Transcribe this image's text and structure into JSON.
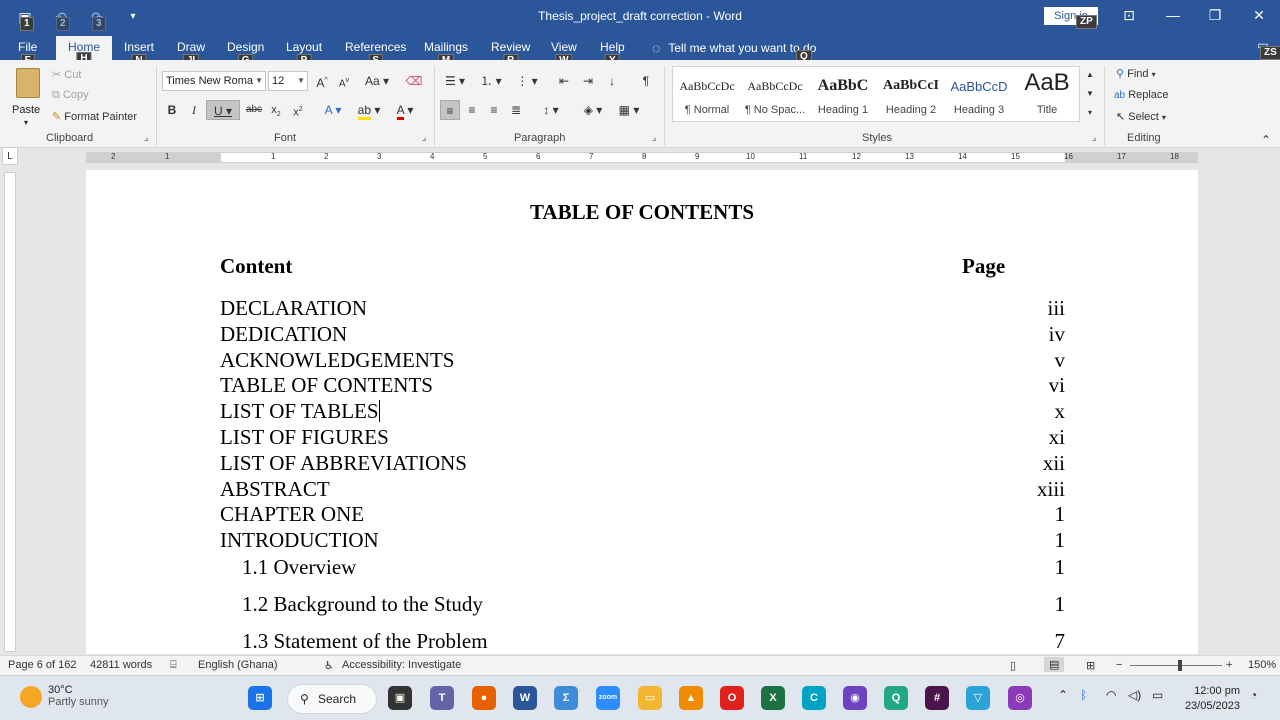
{
  "window": {
    "title": "Thesis_project_draft correction  -  Word",
    "signin_label": "Sign in",
    "signin_keytip": "ZP",
    "qat_keytips": [
      "1",
      "2",
      "3"
    ],
    "tellme_keytip": "Q"
  },
  "tabs": [
    {
      "label": "File",
      "keytip": "F"
    },
    {
      "label": "Home",
      "keytip": "H"
    },
    {
      "label": "Insert",
      "keytip": "N"
    },
    {
      "label": "Draw",
      "keytip": "JI"
    },
    {
      "label": "Design",
      "keytip": "G"
    },
    {
      "label": "Layout",
      "keytip": "P"
    },
    {
      "label": "References",
      "keytip": "S"
    },
    {
      "label": "Mailings",
      "keytip": "M"
    },
    {
      "label": "Review",
      "keytip": "R"
    },
    {
      "label": "View",
      "keytip": "W"
    },
    {
      "label": "Help",
      "keytip": "Y"
    }
  ],
  "tellme": "Tell me what you want to do",
  "ribbon": {
    "clipboard": {
      "paste": "Paste",
      "cut": "Cut",
      "copy": "Copy",
      "format_painter": "Format Painter",
      "label": "Clipboard"
    },
    "font": {
      "name": "Times New Roma",
      "size": "12",
      "label": "Font"
    },
    "paragraph": {
      "label": "Paragraph"
    },
    "styles": {
      "label": "Styles",
      "items": [
        {
          "sample": "AaBbCcDc",
          "name": "¶ Normal"
        },
        {
          "sample": "AaBbCcDc",
          "name": "¶ No Spac..."
        },
        {
          "sample": "AaBbC",
          "name": "Heading 1"
        },
        {
          "sample": "AaBbCcI",
          "name": "Heading 2"
        },
        {
          "sample": "AaBbCcD",
          "name": "Heading 3"
        },
        {
          "sample": "AaB",
          "name": "Title"
        }
      ]
    },
    "editing": {
      "find": "Find",
      "replace": "Replace",
      "select": "Select",
      "label": "Editing"
    },
    "collapse_keytip": "ZS"
  },
  "ruler_ticks": [
    "2",
    "1",
    "1",
    "2",
    "3",
    "4",
    "5",
    "6",
    "7",
    "8",
    "9",
    "10",
    "11",
    "12",
    "13",
    "14",
    "15",
    "16",
    "17",
    "18"
  ],
  "document": {
    "title": "TABLE OF CONTENTS",
    "col_content": "Content",
    "col_page": "Page",
    "rows": [
      {
        "text": "DECLARATION",
        "page": "iii"
      },
      {
        "text": "DEDICATION",
        "page": "iv"
      },
      {
        "text": "ACKNOWLEDGEMENTS",
        "page": "v"
      },
      {
        "text": "TABLE OF CONTENTS",
        "page": "vi"
      },
      {
        "text": "LIST OF TABLES",
        "page": "x"
      },
      {
        "text": "LIST OF FIGURES",
        "page": "xi"
      },
      {
        "text": "LIST OF ABBREVIATIONS",
        "page": "xii"
      },
      {
        "text": "ABSTRACT",
        "page": "xiii"
      },
      {
        "text": "CHAPTER ONE",
        "page": "1"
      },
      {
        "text": "INTRODUCTION",
        "page": "1"
      },
      {
        "text": "1.1 Overview",
        "page": "1"
      },
      {
        "text": "1.2 Background to the Study",
        "page": "1"
      },
      {
        "text": "1.3 Statement of the Problem",
        "page": "7"
      }
    ]
  },
  "statusbar": {
    "page": "Page 6 of 162",
    "words": "42811 words",
    "language": "English (Ghana)",
    "accessibility": "Accessibility: Investigate",
    "zoom": "150%"
  },
  "taskbar": {
    "temperature": "30°C",
    "weather": "Partly sunny",
    "search": "Search",
    "time": "12:00 pm",
    "date": "23/05/2023"
  }
}
